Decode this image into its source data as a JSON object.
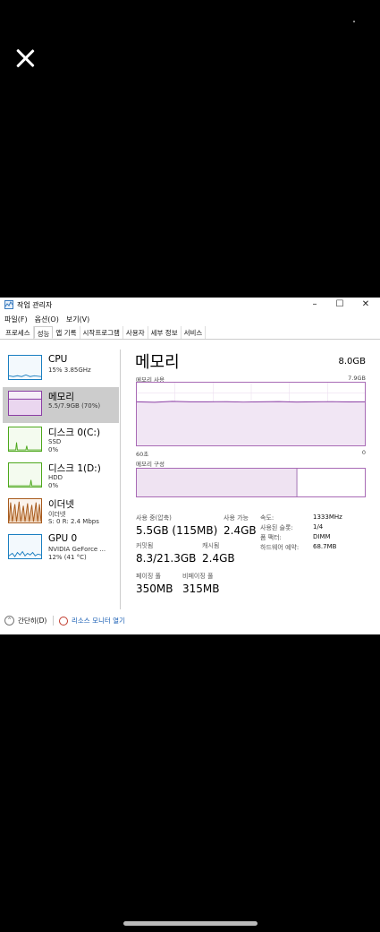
{
  "window": {
    "title": "작업 관리자"
  },
  "menu": [
    "파일(F)",
    "옵션(O)",
    "보기(V)"
  ],
  "tabs": [
    "프로세스",
    "성능",
    "앱 기록",
    "시작프로그램",
    "사용자",
    "세부 정보",
    "서비스"
  ],
  "active_tab": 1,
  "sidebar": {
    "items": [
      {
        "name": "CPU",
        "lines": [
          "15% 3.85GHz"
        ],
        "color": "#1b7fc1"
      },
      {
        "name": "메모리",
        "lines": [
          "5.5/7.9GB (70%)"
        ],
        "color": "#8b3ea4"
      },
      {
        "name": "디스크 0(C:)",
        "lines": [
          "SSD",
          "0%"
        ],
        "color": "#4da81c"
      },
      {
        "name": "디스크 1(D:)",
        "lines": [
          "HDD",
          "0%"
        ],
        "color": "#4da81c"
      },
      {
        "name": "이더넷",
        "lines": [
          "이더넷",
          "S: 0 R: 2.4 Mbps"
        ],
        "color": "#a75a1c"
      },
      {
        "name": "GPU 0",
        "lines": [
          "NVIDIA GeForce ...",
          "12% (41 °C)"
        ],
        "color": "#1b7fc1"
      }
    ]
  },
  "main": {
    "title": "메모리",
    "total": "8.0GB",
    "usage_label": "메모리 사용",
    "usage_max": "7.9GB",
    "x_left": "60초",
    "x_right": "0",
    "composition_label": "메모리 구성",
    "in_use_fraction": 0.7,
    "stats": {
      "in_use_label": "사용 중(압축)",
      "in_use_value": "5.5GB (115MB)",
      "available_label": "사용 가능",
      "available_value": "2.4GB",
      "committed_label": "커밋됨",
      "committed_value": "8.3/21.3GB",
      "cached_label": "캐시됨",
      "cached_value": "2.4GB",
      "paged_label": "페이징 풀",
      "paged_value": "350MB",
      "nonpaged_label": "비페이징 풀",
      "nonpaged_value": "315MB"
    },
    "right": {
      "speed_label": "속도:",
      "speed_value": "1333MHz",
      "slots_label": "사용된 슬롯:",
      "slots_value": "1/4",
      "form_label": "폼 팩터:",
      "form_value": "DIMM",
      "hwres_label": "하드웨어 예약:",
      "hwres_value": "68.7MB"
    }
  },
  "footer": {
    "fewer": "간단히(D)",
    "monitor": "리소스 모니터 열기"
  }
}
